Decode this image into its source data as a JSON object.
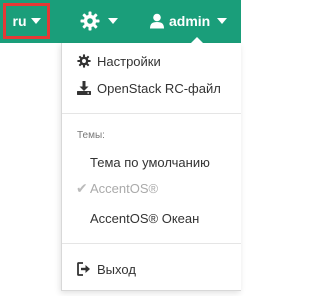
{
  "topbar": {
    "lang_label": "ru",
    "user_label": "admin",
    "colors": {
      "bar": "#1a9e7a",
      "highlight_border": "#e53935"
    }
  },
  "menu": {
    "settings_label": "Настройки",
    "rc_file_label": "OpenStack RC-файл",
    "themes_header": "Темы:",
    "themes": [
      {
        "label": "Тема по умолчанию",
        "selected": false
      },
      {
        "label": "AccentOS®",
        "selected": true
      },
      {
        "label": "AccentOS® Океан",
        "selected": false
      }
    ],
    "logout_label": "Выход"
  },
  "icons": [
    "caret-down-icon",
    "gear-icon",
    "user-icon",
    "download-icon",
    "check-icon",
    "sign-out-icon"
  ]
}
